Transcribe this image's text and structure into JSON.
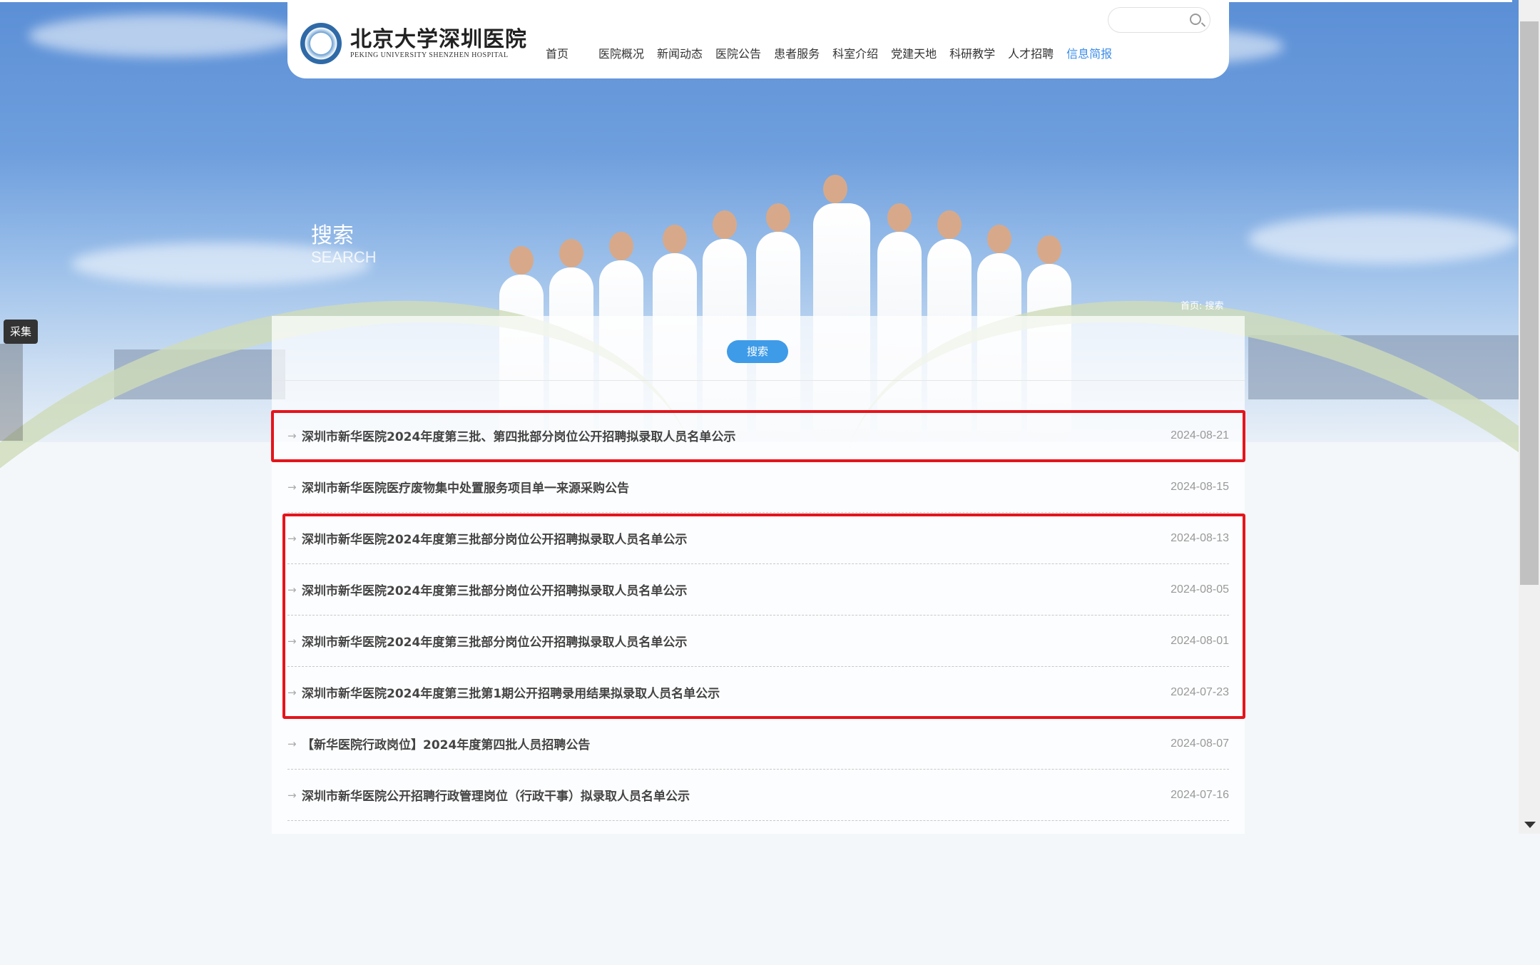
{
  "header": {
    "logo_cn": "北京大学深圳医院",
    "logo_en": "PEKING UNIVERSITY SHENZHEN HOSPITAL",
    "nav": [
      "首页",
      "医院概况",
      "新闻动态",
      "医院公告",
      "患者服务",
      "科室介绍",
      "党建天地",
      "科研教学",
      "人才招聘",
      "信息简报"
    ],
    "active_nav_color": "#3b8de8"
  },
  "page": {
    "title_cn": "搜索",
    "title_en": "SEARCH",
    "breadcrumb": "首页: 搜索",
    "collect_label": "采集",
    "search_button": "搜索"
  },
  "results": [
    {
      "title": "深圳市新华医院2024年度第三批、第四批部分岗位公开招聘拟录取人员名单公示",
      "date": "2024-08-21"
    },
    {
      "title": "深圳市新华医院医疗废物集中处置服务项目单一来源采购公告",
      "date": "2024-08-15"
    },
    {
      "title": "深圳市新华医院2024年度第三批部分岗位公开招聘拟录取人员名单公示",
      "date": "2024-08-13"
    },
    {
      "title": "深圳市新华医院2024年度第三批部分岗位公开招聘拟录取人员名单公示",
      "date": "2024-08-05"
    },
    {
      "title": "深圳市新华医院2024年度第三批部分岗位公开招聘拟录取人员名单公示",
      "date": "2024-08-01"
    },
    {
      "title": "深圳市新华医院2024年度第三批第1期公开招聘录用结果拟录取人员名单公示",
      "date": "2024-07-23"
    },
    {
      "title": "【新华医院行政岗位】2024年度第四批人员招聘公告",
      "date": "2024-08-07"
    },
    {
      "title": "深圳市新华医院公开招聘行政管理岗位（行政干事）拟录取人员名单公示",
      "date": "2024-07-16"
    }
  ],
  "colors": {
    "highlight": "#e5141b",
    "button": "#3e9be8"
  }
}
